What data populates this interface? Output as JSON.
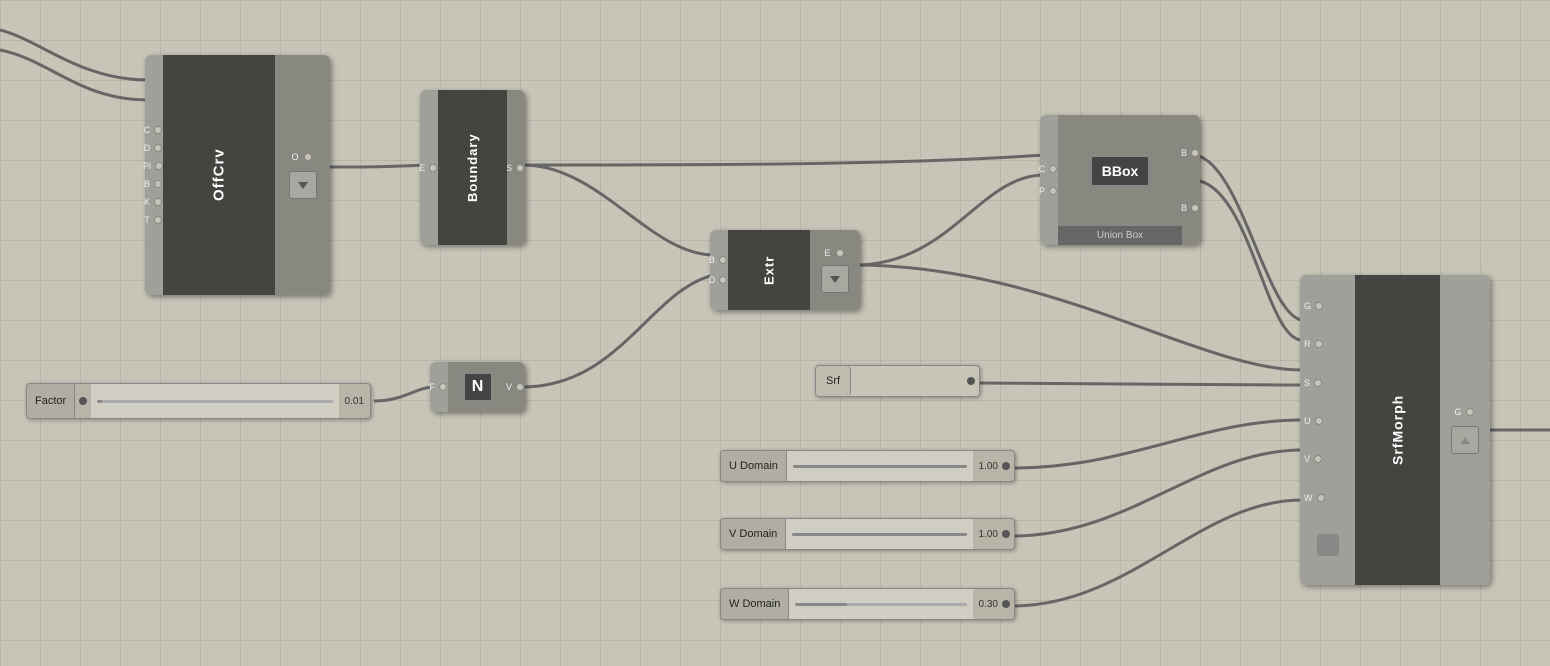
{
  "canvas": {
    "background": "#c8c5b8"
  },
  "nodes": {
    "offcrv": {
      "label": "OffCrv",
      "left_ports": [
        "C",
        "D",
        "Pl",
        "B",
        "K",
        "T"
      ],
      "right_port": "O"
    },
    "boundary": {
      "label": "Boundary",
      "left_port": "E",
      "right_port": "S"
    },
    "extr": {
      "label": "Extr",
      "left_ports": [
        "B",
        "D"
      ],
      "right_port": "E"
    },
    "unionbox": {
      "label": "BBox",
      "subtitle": "Union Box",
      "left_ports": [
        "C",
        "P"
      ],
      "right_ports": [
        "B",
        "B"
      ]
    },
    "nnode": {
      "label": "N",
      "left_port": "F",
      "right_port": "V"
    },
    "srfmorph": {
      "label": "SrfMorph",
      "left_ports": [
        "G",
        "R",
        "S",
        "U",
        "V",
        "W"
      ],
      "right_port": "G"
    }
  },
  "sliders": {
    "factor": {
      "label": "Factor",
      "value": "0.01",
      "fill_pct": 2
    },
    "srf": {
      "label": "Srf"
    },
    "udomain": {
      "label": "U Domain",
      "value": "1.00",
      "fill_pct": 100
    },
    "vdomain": {
      "label": "V Domain",
      "value": "1.00",
      "fill_pct": 100
    },
    "wdomain": {
      "label": "W Domain",
      "value": "0.30",
      "fill_pct": 30
    }
  }
}
